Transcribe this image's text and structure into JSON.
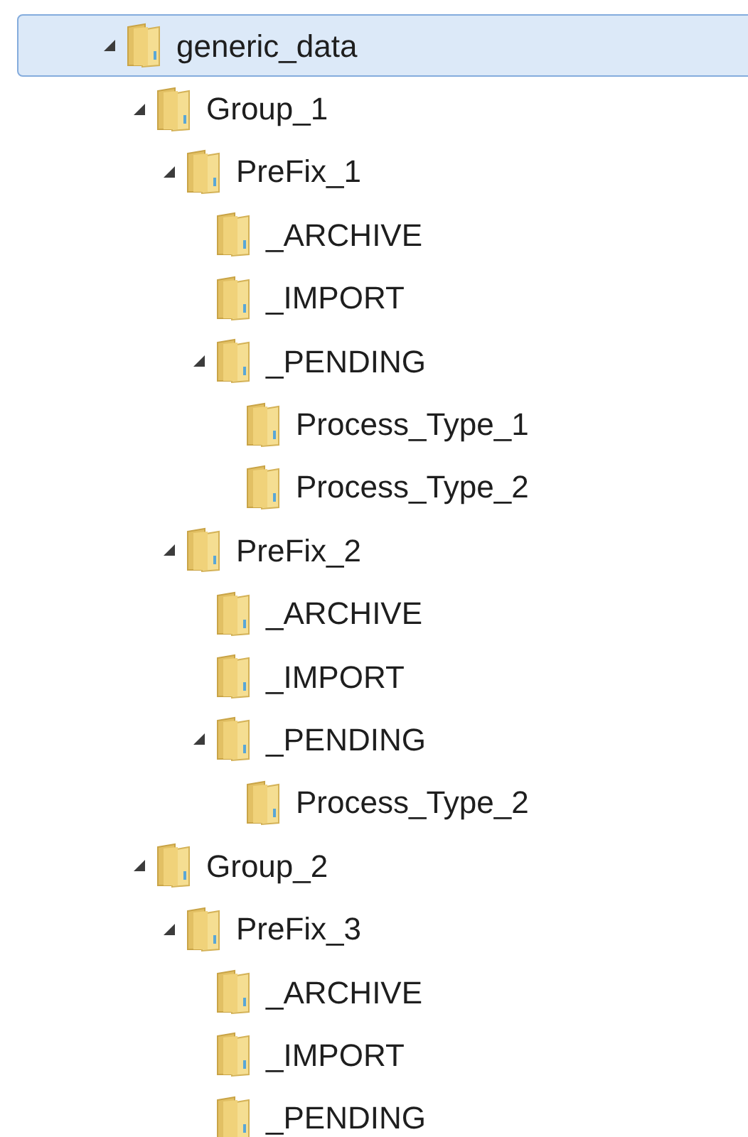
{
  "tree": [
    {
      "label": "generic_data",
      "selected": true,
      "expanded": true,
      "children": [
        {
          "label": "Group_1",
          "selected": false,
          "expanded": true,
          "children": [
            {
              "label": "PreFix_1",
              "selected": false,
              "expanded": true,
              "children": [
                {
                  "label": "_ARCHIVE",
                  "selected": false
                },
                {
                  "label": "_IMPORT",
                  "selected": false
                },
                {
                  "label": "_PENDING",
                  "selected": false,
                  "expanded": true,
                  "children": [
                    {
                      "label": "Process_Type_1",
                      "selected": false
                    },
                    {
                      "label": "Process_Type_2",
                      "selected": false
                    }
                  ]
                }
              ]
            },
            {
              "label": "PreFix_2",
              "selected": false,
              "expanded": true,
              "children": [
                {
                  "label": "_ARCHIVE",
                  "selected": false
                },
                {
                  "label": "_IMPORT",
                  "selected": false
                },
                {
                  "label": "_PENDING",
                  "selected": false,
                  "expanded": true,
                  "children": [
                    {
                      "label": "Process_Type_2",
                      "selected": false
                    }
                  ]
                }
              ]
            }
          ]
        },
        {
          "label": "Group_2",
          "selected": false,
          "expanded": true,
          "children": [
            {
              "label": "PreFix_3",
              "selected": false,
              "expanded": true,
              "children": [
                {
                  "label": "_ARCHIVE",
                  "selected": false
                },
                {
                  "label": "_IMPORT",
                  "selected": false
                },
                {
                  "label": "_PENDING",
                  "selected": false
                }
              ]
            }
          ]
        }
      ]
    }
  ]
}
